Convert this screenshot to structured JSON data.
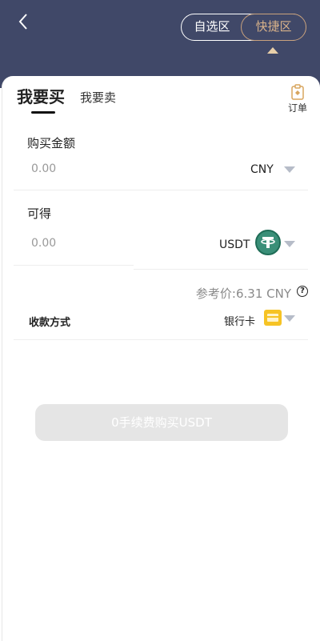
{
  "header": {
    "toggle": {
      "option_favorites": "自选区",
      "option_quick": "快捷区",
      "selected": "快捷区"
    }
  },
  "tabs": {
    "buy": "我要买",
    "sell": "我要卖",
    "active": "buy"
  },
  "orders": {
    "label": "订单"
  },
  "purchase_amount": {
    "label": "购买金额",
    "value": "0.00",
    "currency": "CNY"
  },
  "receive": {
    "label": "可得",
    "value": "0.00",
    "currency": "USDT"
  },
  "reference": {
    "text": "参考价:6.31 CNY",
    "help_glyph": "?"
  },
  "payment": {
    "label": "收款方式",
    "method": "银行卡"
  },
  "submit": {
    "label": "0手续费购买USDT"
  },
  "colors": {
    "header_bg": "#404868",
    "accent_gold": "#c9a27d",
    "button_disabled": "#e5e5e5",
    "tether_green": "#3a8f78"
  },
  "icons": [
    "back-chevron-icon",
    "orders-clipboard-icon",
    "dropdown-caret-icon",
    "tether-usdt-icon",
    "bank-card-icon",
    "help-circle-icon"
  ]
}
